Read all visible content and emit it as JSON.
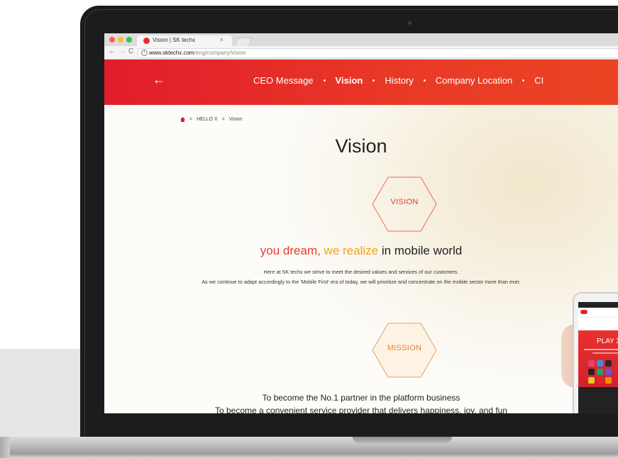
{
  "browser": {
    "tab_title": "Vision | SK techx",
    "tab_close": "×",
    "url_host": "www.sktechx.com",
    "url_path": "/eng/company/vision"
  },
  "site_nav": {
    "back_icon": "←",
    "items": [
      {
        "label": "CEO Message",
        "active": false
      },
      {
        "label": "Vision",
        "active": true
      },
      {
        "label": "History",
        "active": false
      },
      {
        "label": "Company Location",
        "active": false
      },
      {
        "label": "CI",
        "active": false
      }
    ]
  },
  "breadcrumb": {
    "sep1": ">",
    "item1": "HELLO X",
    "sep2": ">",
    "item2": "Vision"
  },
  "page": {
    "title": "Vision",
    "vision_label": "VISION",
    "tagline_part1": "you dream, ",
    "tagline_part2": "we realize",
    "tagline_part3": " in mobile world",
    "vision_desc_1": "Here at SK techx we strive to meet the desired values and services of our customers.",
    "vision_desc_2": "As we continue to adapt accordingly to the 'Mobile First' era of today, we will prioritize and concentrate on the mobile sector more than ever.",
    "mission_label": "MISSION",
    "mission_line_1": "To become the No.1 partner in the platform business",
    "mission_line_2": "To become a convenient service provider that delivers happiness, joy, and fun"
  },
  "phone": {
    "hero_title": "PLAY X"
  },
  "colors": {
    "brand_red": "#e11d2b",
    "accent_orange": "#f0a21a",
    "hex_stroke": "#ec6a56"
  }
}
